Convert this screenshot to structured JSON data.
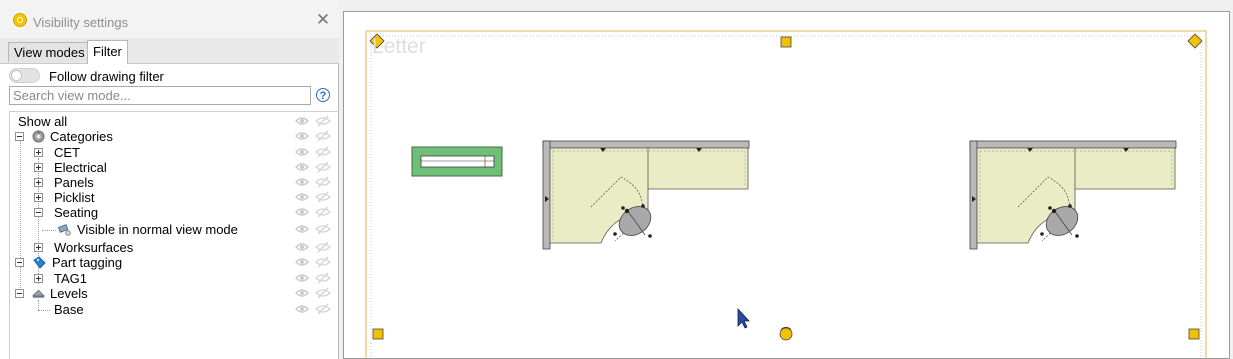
{
  "panel": {
    "title": "Visibility settings",
    "tabs": {
      "view_modes": "View modes",
      "filter": "Filter"
    },
    "follow_drawing_filter": "Follow drawing filter",
    "search": {
      "value": "",
      "placeholder": "Search view mode..."
    },
    "help": "?"
  },
  "tree": {
    "show_all": "Show all",
    "categories": "Categories",
    "cet": "CET",
    "electrical": "Electrical",
    "panels": "Panels",
    "picklist": "Picklist",
    "seating": "Seating",
    "visible_normal": "Visible in normal view mode",
    "worksurfaces": "Worksurfaces",
    "part_tagging": "Part tagging",
    "tag1": "TAG1",
    "levels": "Levels",
    "base": "Base"
  },
  "drawing": {
    "page_label": "Letter"
  },
  "colors": {
    "worksurface": "#e9ecc4",
    "panel_frame": "#b9b9b9",
    "handle": "#f2c200",
    "legend_fill": "#6fbf78",
    "page_border": "#e7b255"
  }
}
